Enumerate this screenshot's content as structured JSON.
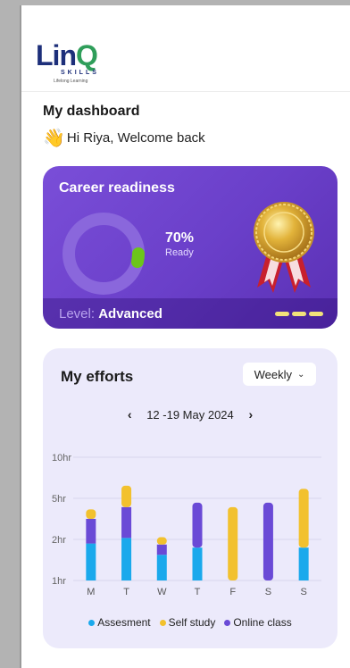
{
  "brand": {
    "logo_main": "Lin",
    "logo_q": "Q",
    "logo_sub": "SKILLS",
    "logo_tagline": "Lifelong Learning"
  },
  "dashboard": {
    "title": "My dashboard",
    "welcome_icon": "waving-hand-icon",
    "welcome": "Hi Riya, Welcome back"
  },
  "career": {
    "title": "Career readiness",
    "percent_text": "70%",
    "percent_value": 70,
    "ready_label": "Ready",
    "level_label": "Level:",
    "level_value": "Advanced",
    "colors": {
      "card": "#6a3fc9",
      "progress": "#6cc51a",
      "track": "#8a67dc"
    }
  },
  "efforts": {
    "title": "My efforts",
    "period": "Weekly",
    "date_range": "12 -19 May 2024",
    "prev": "‹",
    "next": "›"
  },
  "chart_data": {
    "type": "bar",
    "stacked": true,
    "categories": [
      "M",
      "T",
      "W",
      "T",
      "F",
      "S",
      "S"
    ],
    "y_ticks": [
      "1hr",
      "2hr",
      "5hr",
      "10hr"
    ],
    "series": [
      {
        "name": "Assesment",
        "color": "#1aa9ec",
        "values": [
          1.8,
          2.1,
          1.25,
          1.6,
          0,
          0,
          1.6
        ]
      },
      {
        "name": "Online class",
        "color": "#6a4ad6",
        "values": [
          1.6,
          2.1,
          0.5,
          2.9,
          0,
          4.5,
          0
        ]
      },
      {
        "name": "Self study",
        "color": "#f2c12e",
        "values": [
          0.65,
          2.2,
          0.4,
          0,
          4.2,
          0,
          4.4
        ]
      }
    ],
    "grid": true,
    "legend": "bottom"
  }
}
